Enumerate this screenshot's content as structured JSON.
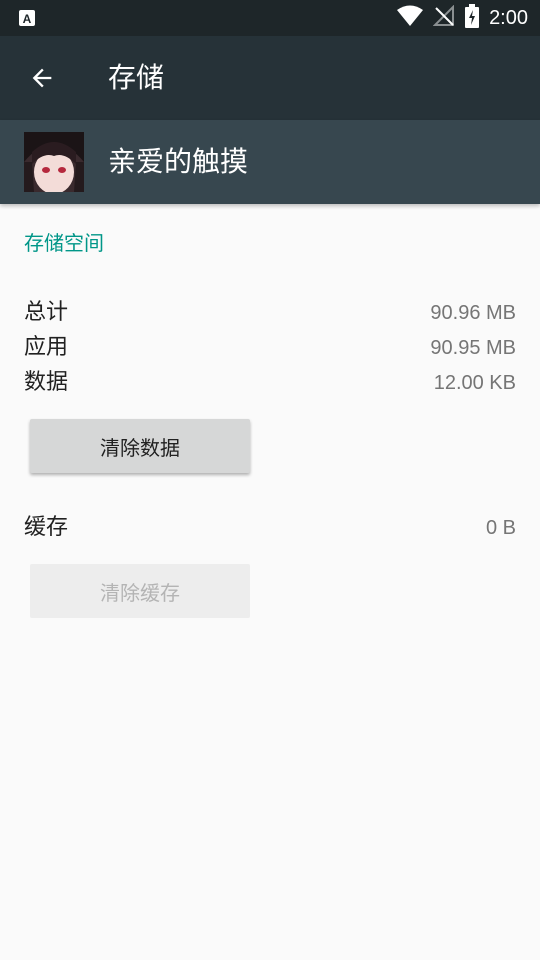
{
  "status_bar": {
    "time": "2:00",
    "icons": [
      "notification-a-icon",
      "wifi-icon",
      "no-signal-icon",
      "battery-charging-icon"
    ]
  },
  "app_bar": {
    "title": "存储",
    "back_icon": "arrow-back-icon"
  },
  "app_header": {
    "app_name": "亲爱的触摸",
    "icon": "app-avatar-icon"
  },
  "storage": {
    "section_title": "存储空间",
    "rows": [
      {
        "label": "总计",
        "value": "90.96 MB"
      },
      {
        "label": "应用",
        "value": "90.95 MB"
      },
      {
        "label": "数据",
        "value": "12.00 KB"
      }
    ],
    "clear_data_label": "清除数据"
  },
  "cache": {
    "label": "缓存",
    "value": "0 B",
    "clear_cache_label": "清除缓存"
  },
  "colors": {
    "accent": "#009688",
    "app_bar": "#263238",
    "header": "#37474f"
  }
}
